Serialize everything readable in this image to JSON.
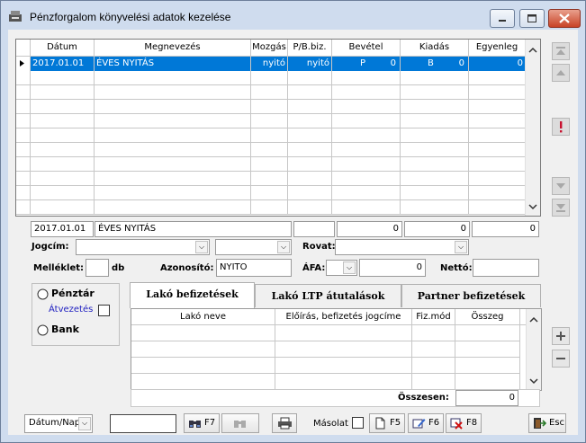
{
  "window": {
    "title": "Pénzforgalom könyvelési adatok kezelése"
  },
  "grid": {
    "columns": [
      "Dátum",
      "Megnevezés",
      "Mozgás",
      "P/B.biz.",
      "Bevétel",
      "Kiadás",
      "Egyenleg"
    ],
    "rows": [
      {
        "datum": "2017.01.01",
        "megnevezes": "ÉVES NYITÁS",
        "mozgas": "nyitó",
        "pbbiz": "nyitó",
        "bevetel_p": "P",
        "bevetel": "0",
        "kiadas_b": "B",
        "kiadas": "0",
        "egyenleg": "0"
      }
    ]
  },
  "detail": {
    "datum": "2017.01.01",
    "megnevezes": "ÉVES NYITÁS",
    "bevetel": "0",
    "kiadas": "0",
    "egyenleg": "0",
    "jogcim_label": "Jogcím:",
    "rovat_label": "Rovat:",
    "melleklet_label": "Melléklet:",
    "db_label": "db",
    "azonosito_label": "Azonosító:",
    "azonosito_value": "NYITO",
    "afa_label": "ÁFA:",
    "afa_value": "0",
    "netto_label": "Nettó:"
  },
  "payment": {
    "penztar": "Pénztár",
    "atvezetes": "Átvezetés",
    "bank": "Bank"
  },
  "tabs": [
    "Lakó befizetések",
    "Lakó LTP átutalások",
    "Partner befizetések"
  ],
  "subgrid": {
    "columns": [
      "Lakó neve",
      "Előírás, befizetés jogcíme",
      "Fiz.mód",
      "Összeg"
    ],
    "total_label": "Összesen:",
    "total_value": "0"
  },
  "footer": {
    "sort_value": "Dátum/Nap",
    "f7": "F7",
    "masolat": "Másolat",
    "f5": "F5",
    "f6": "F6",
    "f8": "F8",
    "esc": "Esc"
  }
}
